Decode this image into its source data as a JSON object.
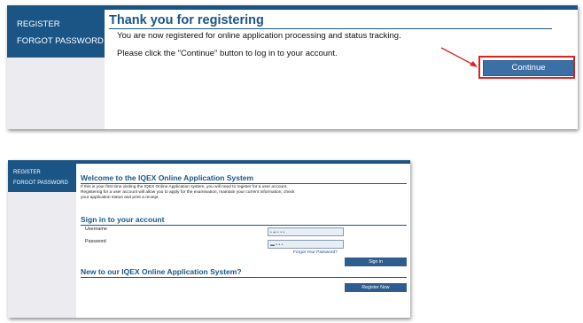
{
  "panel1": {
    "sidebar": {
      "items": [
        {
          "label": "REGISTER"
        },
        {
          "label": "FORGOT PASSWORD"
        }
      ]
    },
    "title": "Thank you for registering",
    "line1": "You are now registered for online application processing and status tracking.",
    "line2": "Please click the \"Continue\" button to log in to your account.",
    "continue_label": "Continue",
    "highlight_color": "#e02020"
  },
  "panel2": {
    "sidebar": {
      "items": [
        {
          "label": "REGISTER"
        },
        {
          "label": "FORGOT PASSWORD"
        }
      ]
    },
    "welcome_title": "Welcome to the IQEX Online Application System",
    "welcome_lines": [
      "If this is your first time visiting the IQEX Online Application system, you will need to register for a user account.",
      "Registering for a user account will allow you to apply for the examination, maintain your current information, check",
      "your application status and print a receipt."
    ],
    "signin_title": "Sign in to your account",
    "username_label": "Username",
    "username_value": "• ▪• • • • .",
    "password_label": "Password",
    "password_value": "▬ • • •",
    "forgot_link": "Forgot Your Password?",
    "signin_label": "Sign in",
    "new_title": "New to our IQEX Online Application System?",
    "register_label": "Register Now"
  },
  "colors": {
    "brand": "#1b5586",
    "button": "#3b6fa5",
    "sidebar_bg": "#ebebf0"
  }
}
